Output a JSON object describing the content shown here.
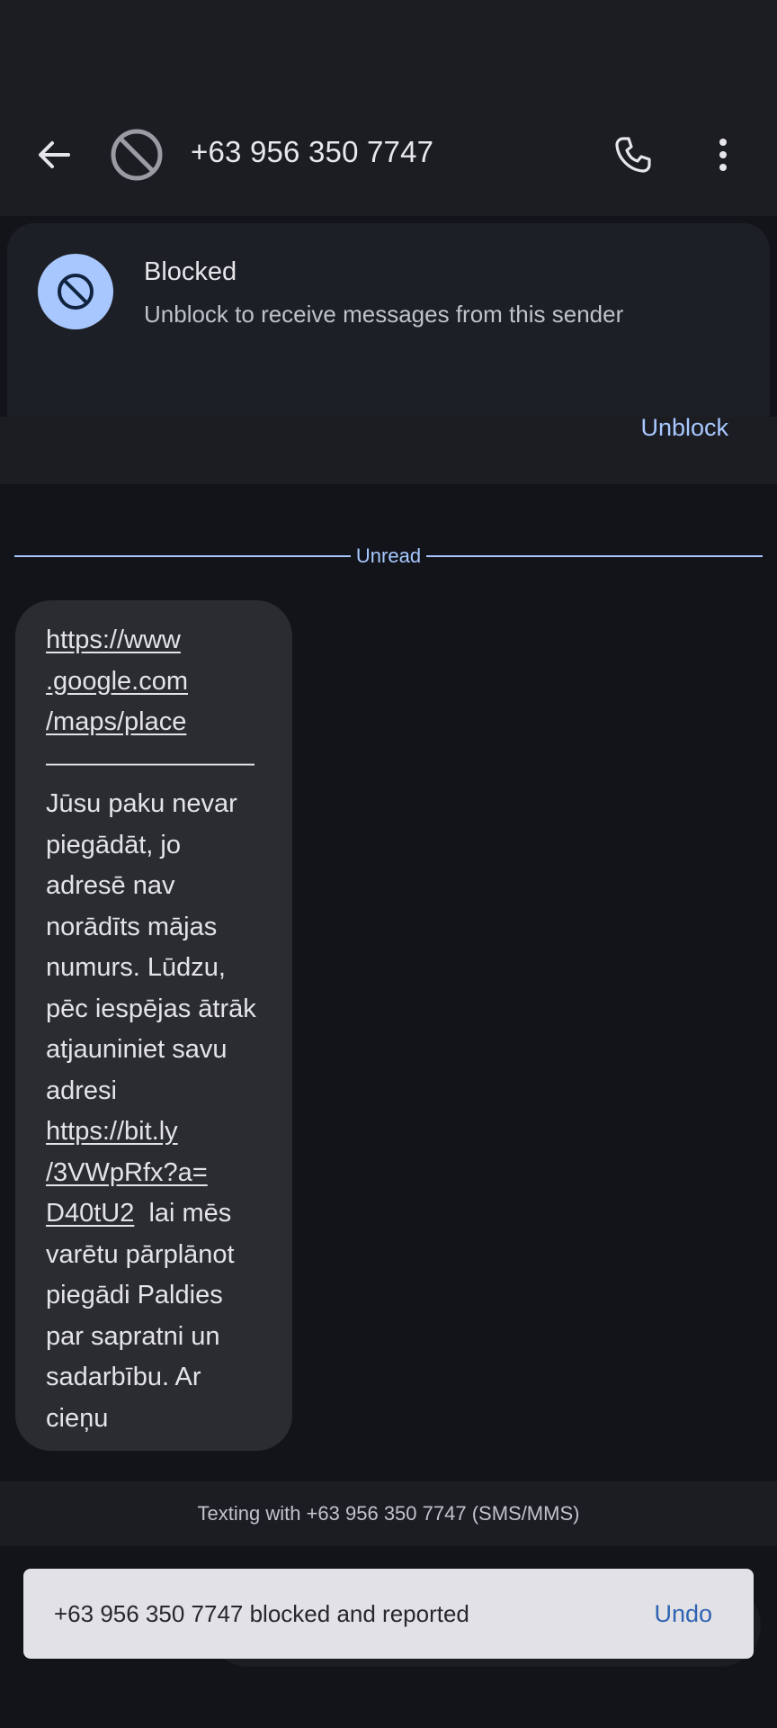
{
  "header": {
    "title": "+63 956 350 7747",
    "back_icon": "arrow-back-icon",
    "avatar_icon": "block-icon",
    "call_icon": "phone-icon",
    "more_icon": "more-vert-icon"
  },
  "blocked_card": {
    "title": "Blocked",
    "subtitle": "Unblock to receive messages from this sender",
    "action_label": "Unblock",
    "icon": "block-icon"
  },
  "divider": {
    "label": "Unread"
  },
  "message": {
    "lines": [
      {
        "text": "https://www",
        "link": true
      },
      {
        "text": ".google.com",
        "link": true
      },
      {
        "text": "/maps/place",
        "link": true
      },
      {
        "text": "————————",
        "link": false
      },
      {
        "text": "Jūsu paku nevar",
        "link": false
      },
      {
        "text": "piegādāt, jo",
        "link": false
      },
      {
        "text": "adresē nav",
        "link": false
      },
      {
        "text": "norādīts mājas",
        "link": false
      },
      {
        "text": "numurs. Lūdzu,",
        "link": false
      },
      {
        "text": "pēc iespējas ātrāk",
        "link": false
      },
      {
        "text": "atjauniniet savu",
        "link": false
      },
      {
        "text": "adresi",
        "link": false
      },
      {
        "text": "https://bit.ly",
        "link": true
      },
      {
        "text": "/3VWpRfx?a=",
        "link": true
      },
      {
        "text": "D40tU2",
        "link": true,
        "after": "  lai mēs"
      },
      {
        "text": "varētu pārplānot",
        "link": false
      },
      {
        "text": "piegādi  Paldies",
        "link": false
      },
      {
        "text": "par sapratni un",
        "link": false
      },
      {
        "text": "sadarbību.  Ar",
        "link": false
      },
      {
        "text": "cieņu",
        "link": false
      }
    ]
  },
  "texting_bar": {
    "text": "Texting with +63 956 350 7747 (SMS/MMS)"
  },
  "snackbar": {
    "text": "+63 956 350 7747 blocked and reported",
    "action_label": "Undo"
  },
  "colors": {
    "background": "#12141a",
    "bar": "#1b1d23",
    "accent": "#a8c8ff",
    "bubble": "#2a2c32",
    "snackbar": "#e2e2e6",
    "snackbar_action": "#2f63b3"
  }
}
